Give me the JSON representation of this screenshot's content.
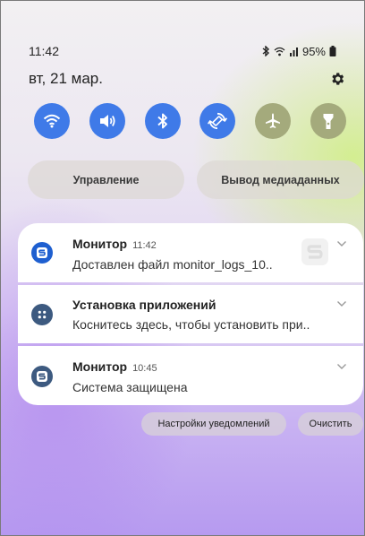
{
  "status": {
    "time": "11:42",
    "battery": "95%"
  },
  "date": "вт, 21 мар.",
  "quick_tiles": [
    {
      "name": "wifi",
      "state": "on"
    },
    {
      "name": "sound",
      "state": "on"
    },
    {
      "name": "bluetooth",
      "state": "on"
    },
    {
      "name": "auto-rotate",
      "state": "on"
    },
    {
      "name": "airplane-mode",
      "state": "off"
    },
    {
      "name": "flashlight",
      "state": "off"
    }
  ],
  "controls": {
    "device_control": "Управление",
    "media_output": "Вывод медиаданных"
  },
  "notifications": [
    {
      "app": "Монитор",
      "time": "11:42",
      "text": "Доставлен файл monitor_logs_10.."
    },
    {
      "app": "Установка приложений",
      "time": "",
      "text": "Коснитесь здесь, чтобы установить при.."
    },
    {
      "app": "Монитор",
      "time": "10:45",
      "text": "Система защищена"
    }
  ],
  "footer": {
    "settings": "Настройки уведомлений",
    "clear": "Очистить"
  },
  "colors": {
    "tile_on": "#3f7ae8",
    "tile_off": "#a4aa7c",
    "monitor_icon": "#1e5fd0",
    "installer_icon": "#3d5a80"
  }
}
